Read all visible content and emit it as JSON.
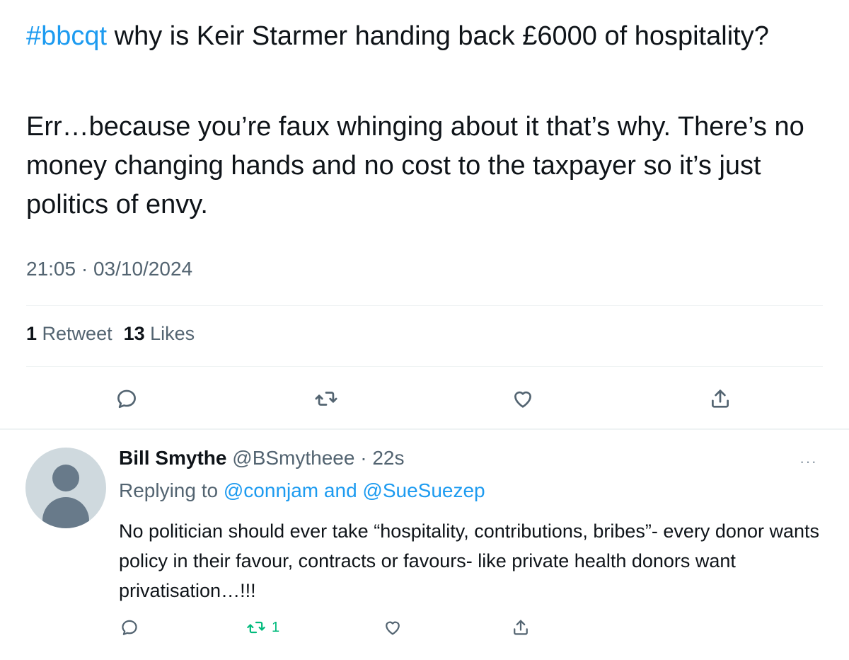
{
  "main_tweet": {
    "hashtag": "#bbcqt",
    "question": " why is Keir Starmer handing back £6000 of hospitality?",
    "body": "Err…because you’re faux whinging about it that’s why. There’s no money changing hands and no cost to the taxpayer so it’s just politics of envy.",
    "timestamp": "21:05 · 03/10/2024",
    "retweet_count": "1",
    "retweet_label": " Retweet",
    "like_count": "13",
    "like_label": " Likes",
    "actions": [
      "reply-icon",
      "retweet-icon",
      "like-icon",
      "share-icon"
    ]
  },
  "reply_tweet": {
    "display_name": "Bill Smythe",
    "handle": "@BSmytheee",
    "time": " · 22s",
    "more": "···",
    "replying_prefix": "Replying to ",
    "mention_1": "@connjam",
    "replying_and": " and ",
    "mention_2": "@SueSuezep",
    "text": "No politician should ever take “hospitality, contributions, bribes”- every donor wants policy in their favour, contracts or favours- like private health donors want privatisation…!!!",
    "retweet_count": "1",
    "retweet_color": "#00ba7c",
    "actions": [
      "reply-icon",
      "retweet-icon",
      "like-icon",
      "share-icon"
    ]
  },
  "colors": {
    "accent": "#1d9bf0",
    "text": "#0f1419",
    "secondary": "#536471",
    "divider": "#eff3f4"
  }
}
